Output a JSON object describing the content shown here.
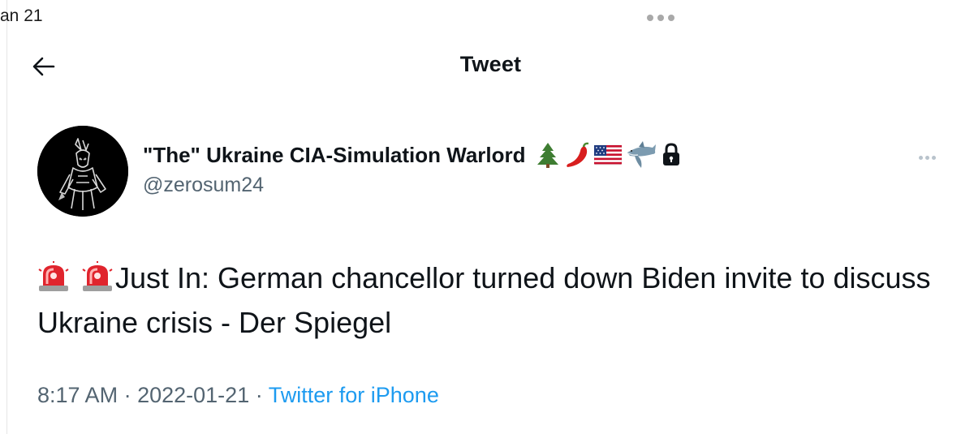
{
  "top": {
    "date_fragment": "an 21"
  },
  "header": {
    "title": "Tweet"
  },
  "tweet": {
    "author": {
      "display_name": "\"The\" Ukraine CIA-Simulation Warlord",
      "handle": "@zerosum24",
      "name_emojis": [
        "evergreen-tree-icon",
        "chili-pepper-icon",
        "us-flag-icon",
        "shark-icon",
        "lock-icon"
      ]
    },
    "text_prefix_icons": [
      "police-light-icon",
      "police-light-icon"
    ],
    "text": "Just In: German chancellor turned down Biden invite to discuss Ukraine crisis - Der Spiegel",
    "time": "8:17 AM",
    "separator": "·",
    "date": "2022-01-21",
    "source": "Twitter for iPhone"
  },
  "colors": {
    "text": "#0f1419",
    "secondary": "#536471",
    "link": "#1d9bf0"
  }
}
